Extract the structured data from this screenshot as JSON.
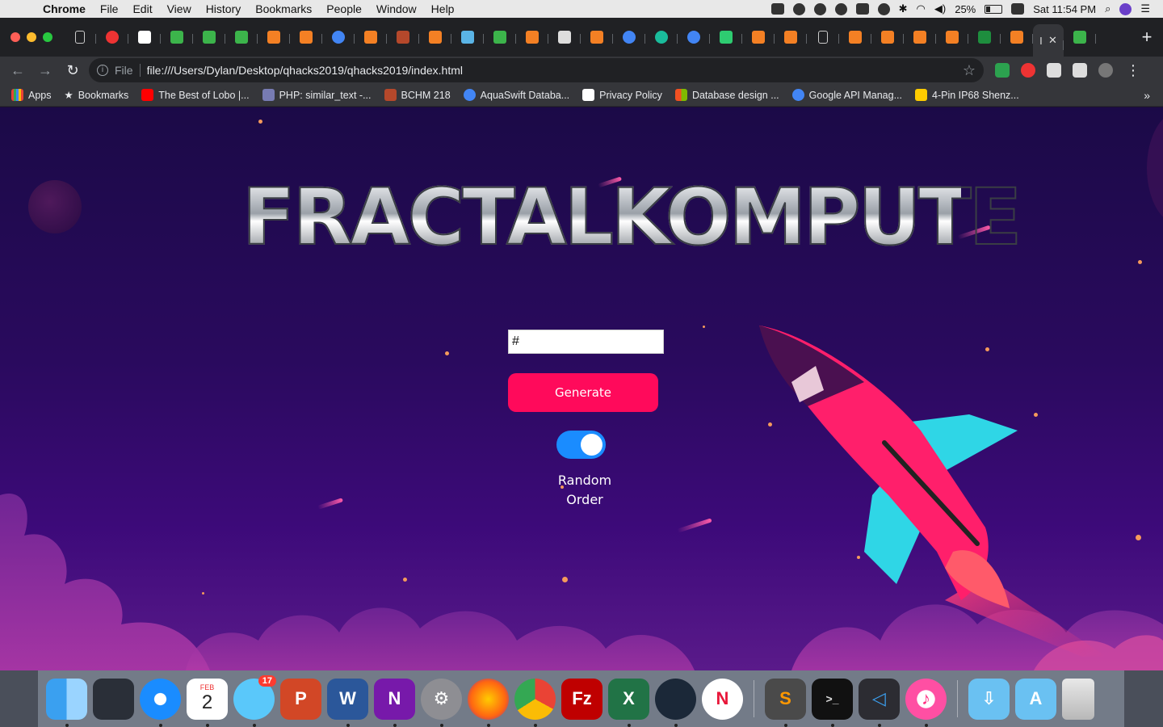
{
  "menubar": {
    "app_name": "Chrome",
    "items": [
      "File",
      "Edit",
      "View",
      "History",
      "Bookmarks",
      "People",
      "Window",
      "Help"
    ],
    "battery": "25%",
    "clock": "Sat 11:54 PM"
  },
  "browser": {
    "url_scheme": "File",
    "url": "file:///Users/Dylan/Desktop/qhacks2019/qhacks2019/index.html",
    "active_tab_label": "I",
    "bookmarks": [
      {
        "label": "Apps",
        "color": "#e94235"
      },
      {
        "label": "Bookmarks",
        "color": "#9aa0a6"
      },
      {
        "label": "The Best of Lobo |...",
        "color": "#ff0000"
      },
      {
        "label": "PHP: similar_text -...",
        "color": "#777bb3"
      },
      {
        "label": "BCHM 218",
        "color": "#b5482b"
      },
      {
        "label": "AquaSwift Databa...",
        "color": "#4285f4"
      },
      {
        "label": "Privacy Policy",
        "color": "#ffffff"
      },
      {
        "label": "Database design ...",
        "color": "#f25022"
      },
      {
        "label": "Google API Manag...",
        "color": "#4285f4"
      },
      {
        "label": "4-Pin IP68 Shenz...",
        "color": "#ffcc00"
      }
    ],
    "more_bookmarks": "»"
  },
  "page": {
    "title": "FRACTALKOMPUTE",
    "input_placeholder": "#",
    "generate_label": "Generate",
    "toggle_on": true,
    "toggle_label_line1": "Random",
    "toggle_label_line2": "Order"
  },
  "dock": {
    "calendar_month": "FEB",
    "calendar_day": "2",
    "messages_badge": "17"
  },
  "colors": {
    "generate_button": "#ff0a5b",
    "toggle": "#1a8cff",
    "rocket_body": "#ff1f6b",
    "rocket_fins": "#2fd6e6"
  }
}
